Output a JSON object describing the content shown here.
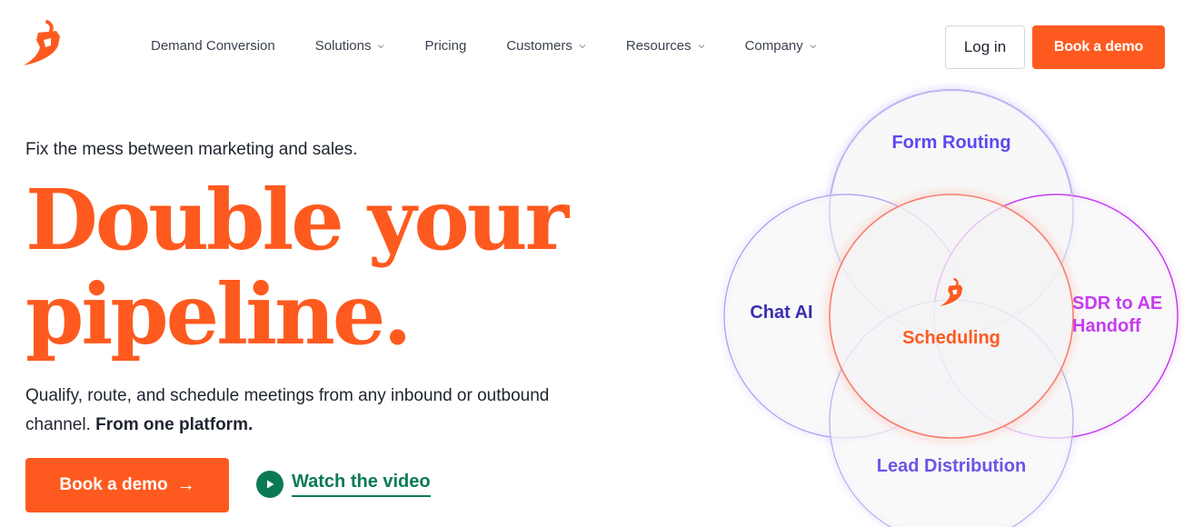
{
  "header": {
    "logo_icon": "chili-pepper-logo-icon",
    "nav": [
      {
        "label": "Demand Conversion",
        "has_dropdown": false
      },
      {
        "label": "Solutions",
        "has_dropdown": true
      },
      {
        "label": "Pricing",
        "has_dropdown": false
      },
      {
        "label": "Customers",
        "has_dropdown": true
      },
      {
        "label": "Resources",
        "has_dropdown": true
      },
      {
        "label": "Company",
        "has_dropdown": true
      }
    ],
    "login_label": "Log in",
    "demo_label": "Book a demo"
  },
  "hero": {
    "eyebrow": "Fix the mess between marketing and sales.",
    "headline_line1": "Double your",
    "headline_line2": "pipeline.",
    "sub_text": "Qualify, route, and schedule meetings from any inbound or outbound channel. ",
    "sub_bold": "From one platform.",
    "cta_label": "Book a demo",
    "cta_arrow": "→",
    "video_label": "Watch the video"
  },
  "venn": {
    "top": "Form Routing",
    "left": "Chat AI",
    "right_line1": "SDR to AE",
    "right_line2": "Handoff",
    "center": "Scheduling",
    "bottom": "Lead Distribution"
  },
  "colors": {
    "brand_orange": "#fe5a1f",
    "link_green": "#0a7a55",
    "form_routing": "#5b49f0",
    "chat_ai": "#3a2fb0",
    "sdr_handoff": "#c53cf0",
    "lead_distribution": "#6a55e6"
  }
}
